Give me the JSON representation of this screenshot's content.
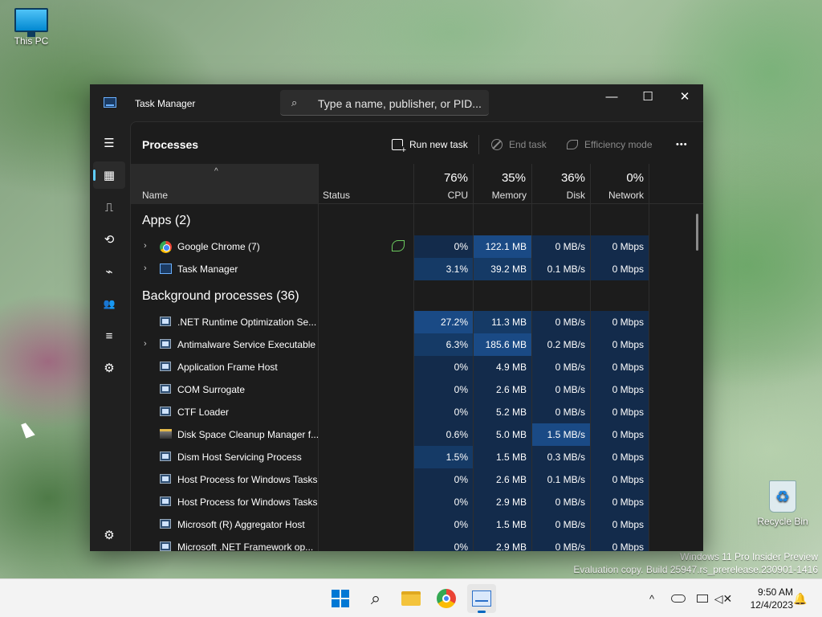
{
  "desktop": {
    "this_pc": "This PC",
    "recycle_bin": "Recycle Bin",
    "watermark_line1": "Windows 11 Pro Insider Preview",
    "watermark_line2": "Evaluation copy. Build 25947.rs_prerelease.230901-1416"
  },
  "window": {
    "title": "Task Manager",
    "search_placeholder": "Type a name, publisher, or PID...",
    "controls": {
      "minimize": "—",
      "maximize": "☐",
      "close": "✕"
    }
  },
  "sidebar": {
    "items": [
      {
        "icon": "hamburger-menu-icon",
        "glyph": "☰"
      },
      {
        "icon": "processes-icon",
        "glyph": "▦",
        "active": true
      },
      {
        "icon": "performance-icon",
        "glyph": "⎍"
      },
      {
        "icon": "app-history-icon",
        "glyph": "⟲"
      },
      {
        "icon": "startup-apps-icon",
        "glyph": "⌁"
      },
      {
        "icon": "users-icon",
        "glyph": "👥"
      },
      {
        "icon": "details-icon",
        "glyph": "≡"
      },
      {
        "icon": "services-icon",
        "glyph": "⚙"
      }
    ],
    "settings_glyph": "⚙"
  },
  "toolbar": {
    "page_title": "Processes",
    "run_new_task": "Run new task",
    "end_task": "End task",
    "efficiency_mode": "Efficiency mode",
    "more": "•••"
  },
  "columns": {
    "name": "Name",
    "status": "Status",
    "cpu_pct": "76%",
    "cpu": "CPU",
    "memory_pct": "35%",
    "memory": "Memory",
    "disk_pct": "36%",
    "disk": "Disk",
    "network_pct": "0%",
    "network": "Network",
    "sort_glyph": "^"
  },
  "groups": {
    "apps": "Apps (2)",
    "background": "Background processes (36)"
  },
  "apps": [
    {
      "name": "Google Chrome (7)",
      "cpu": "0%",
      "memory": "122.1 MB",
      "disk": "0 MB/s",
      "network": "0 Mbps",
      "expand": "›"
    },
    {
      "name": "Task Manager",
      "cpu": "3.1%",
      "memory": "39.2 MB",
      "disk": "0.1 MB/s",
      "network": "0 Mbps",
      "expand": "›"
    }
  ],
  "background": [
    {
      "name": ".NET Runtime Optimization Se...",
      "cpu": "27.2%",
      "memory": "11.3 MB",
      "disk": "0 MB/s",
      "network": "0 Mbps"
    },
    {
      "name": "Antimalware Service Executable",
      "cpu": "6.3%",
      "memory": "185.6 MB",
      "disk": "0.2 MB/s",
      "network": "0 Mbps",
      "expand": "›"
    },
    {
      "name": "Application Frame Host",
      "cpu": "0%",
      "memory": "4.9 MB",
      "disk": "0 MB/s",
      "network": "0 Mbps"
    },
    {
      "name": "COM Surrogate",
      "cpu": "0%",
      "memory": "2.6 MB",
      "disk": "0 MB/s",
      "network": "0 Mbps"
    },
    {
      "name": "CTF Loader",
      "cpu": "0%",
      "memory": "5.2 MB",
      "disk": "0 MB/s",
      "network": "0 Mbps"
    },
    {
      "name": "Disk Space Cleanup Manager f...",
      "cpu": "0.6%",
      "memory": "5.0 MB",
      "disk": "1.5 MB/s",
      "network": "0 Mbps"
    },
    {
      "name": "Dism Host Servicing Process",
      "cpu": "1.5%",
      "memory": "1.5 MB",
      "disk": "0.3 MB/s",
      "network": "0 Mbps"
    },
    {
      "name": "Host Process for Windows Tasks",
      "cpu": "0%",
      "memory": "2.6 MB",
      "disk": "0.1 MB/s",
      "network": "0 Mbps"
    },
    {
      "name": "Host Process for Windows Tasks",
      "cpu": "0%",
      "memory": "2.9 MB",
      "disk": "0 MB/s",
      "network": "0 Mbps"
    },
    {
      "name": "Microsoft (R) Aggregator Host",
      "cpu": "0%",
      "memory": "1.5 MB",
      "disk": "0 MB/s",
      "network": "0 Mbps"
    },
    {
      "name": "Microsoft .NET Framework op...",
      "cpu": "0%",
      "memory": "2.9 MB",
      "disk": "0 MB/s",
      "network": "0 Mbps"
    }
  ],
  "taskbar": {
    "time": "9:50 AM",
    "date": "12/4/2023",
    "chevron": "^",
    "search_glyph": "⌕",
    "bell_glyph": "🔔"
  },
  "colors": {
    "accent": "#60cdff",
    "heat_low": "#132b4b",
    "heat_mid": "#153a66",
    "heat_high": "#1a4a85",
    "efficiency_leaf": "#6ccb5f"
  }
}
